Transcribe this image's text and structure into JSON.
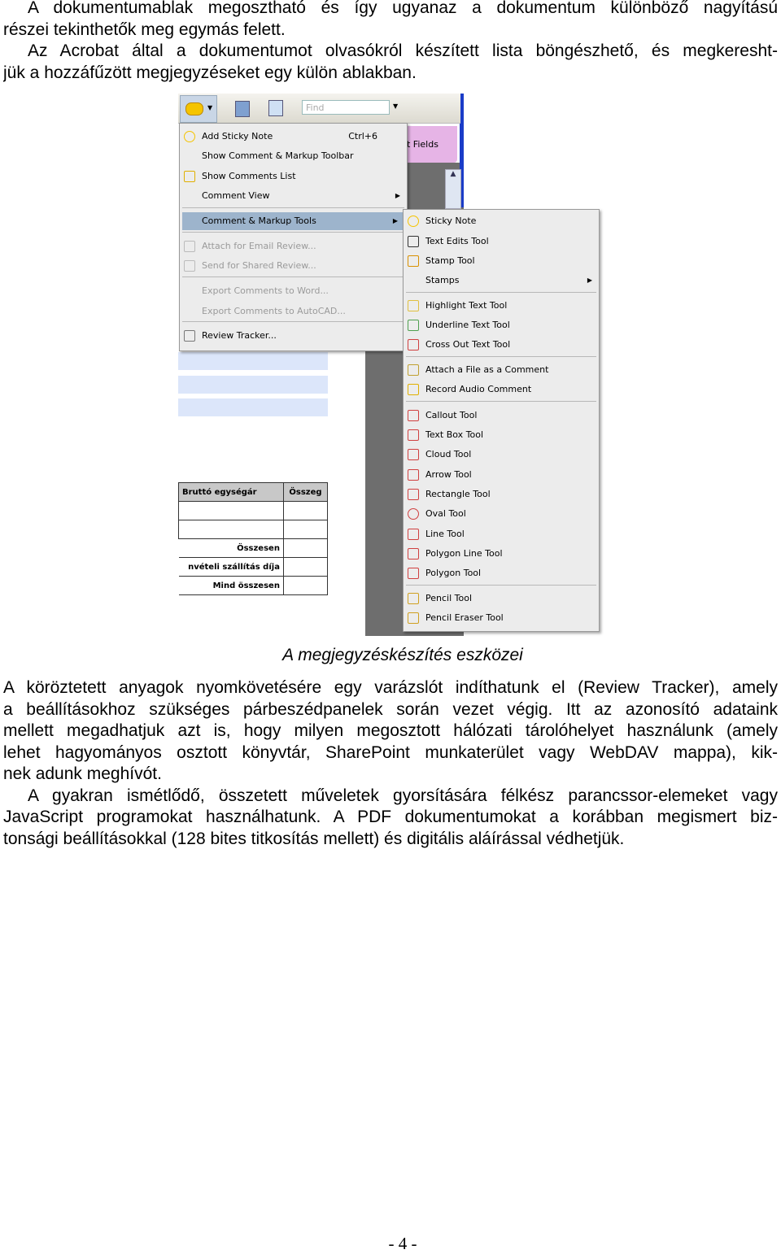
{
  "para1": {
    "lines": [
      "A dokumentumablak megosztható és így ugyanaz a dokumentum különböző nagyítású",
      "részei tekinthetők meg egymás felett.",
      "Az Acrobat által a dokumentumot olvasókról készített lista böngészhető, és megkeresht-",
      "jük a hozzáfűzött megjegyzéseket egy külön ablakban."
    ]
  },
  "screenshot": {
    "find_placeholder": "Find",
    "tab_label": "t Fields",
    "main_menu": [
      {
        "label": "Add Sticky Note",
        "shortcut": "Ctrl+6",
        "icon": "sticky-note-icon"
      },
      {
        "label": "Show Comment & Markup Toolbar"
      },
      {
        "label": "Show Comments List",
        "icon": "comments-list-icon"
      },
      {
        "label": "Comment View",
        "submenu": true
      },
      {
        "label": "Comment & Markup Tools",
        "submenu": true,
        "highlighted": true
      },
      {
        "label": "Attach for Email Review...",
        "disabled": true,
        "icon": "email-review-icon"
      },
      {
        "label": "Send for Shared Review...",
        "disabled": true,
        "icon": "shared-review-icon"
      },
      {
        "label": "Export Comments to Word...",
        "disabled": true
      },
      {
        "label": "Export Comments to AutoCAD...",
        "disabled": true
      },
      {
        "label": "Review Tracker...",
        "icon": "review-tracker-icon"
      }
    ],
    "sub_menu": [
      {
        "label": "Sticky Note",
        "icon": "sticky-note-icon"
      },
      {
        "label": "Text Edits Tool",
        "icon": "text-edits-icon"
      },
      {
        "label": "Stamp Tool",
        "icon": "stamp-icon"
      },
      {
        "label": "Stamps",
        "submenu": true
      },
      {
        "label": "Highlight Text Tool",
        "icon": "highlight-icon"
      },
      {
        "label": "Underline Text Tool",
        "icon": "underline-icon"
      },
      {
        "label": "Cross Out Text Tool",
        "icon": "cross-out-icon"
      },
      {
        "label": "Attach a File as a Comment",
        "icon": "paperclip-icon"
      },
      {
        "label": "Record Audio Comment",
        "icon": "speaker-icon"
      },
      {
        "label": "Callout Tool",
        "icon": "callout-icon"
      },
      {
        "label": "Text Box Tool",
        "icon": "text-box-icon"
      },
      {
        "label": "Cloud Tool",
        "icon": "cloud-icon"
      },
      {
        "label": "Arrow Tool",
        "icon": "arrow-icon"
      },
      {
        "label": "Rectangle Tool",
        "icon": "rectangle-icon"
      },
      {
        "label": "Oval Tool",
        "icon": "oval-icon"
      },
      {
        "label": "Line Tool",
        "icon": "line-icon"
      },
      {
        "label": "Polygon Line Tool",
        "icon": "polygon-line-icon"
      },
      {
        "label": "Polygon Tool",
        "icon": "polygon-icon"
      },
      {
        "label": "Pencil Tool",
        "icon": "pencil-icon"
      },
      {
        "label": "Pencil Eraser Tool",
        "icon": "pencil-eraser-icon"
      }
    ],
    "table": {
      "headers": [
        "Bruttó egységár",
        "Összeg"
      ],
      "rows": [
        "Összesen",
        "nvételi szállítás díja",
        "Mind összesen"
      ]
    }
  },
  "caption": "A megjegyzéskészítés eszközei",
  "para2": {
    "lines": [
      "A köröztetett anyagok nyomkövetésére egy varázslót indíthatunk el (Review Tracker), amely",
      "a beállításokhoz szükséges párbeszédpanelek során vezet végig. Itt az azonosító adataink",
      "mellett megadhatjuk azt is, hogy milyen megosztott hálózati tárolóhelyet használunk (amely",
      "lehet hagyományos osztott könyvtár, SharePoint munkaterület vagy WebDAV mappa), kik-",
      "nek adunk meghívót."
    ]
  },
  "para3": {
    "lines": [
      "A gyakran ismétlődő, összetett műveletek gyorsítására félkész parancssor-elemeket  vagy",
      "JavaScript programokat használhatunk. A PDF dokumentumokat a korábban megismert biz-",
      "tonsági beállításokkal (128 bites titkosítás mellett) és digitális aláírással védhetjük."
    ]
  },
  "page_number": "- 4 -",
  "colors": {
    "highlight": "#9db4cc",
    "menu_bg": "#ececec",
    "dark_bg": "#6e6e6e",
    "pink_tab": "#e6b4e6",
    "blue_strip": "#1a3cc8"
  }
}
